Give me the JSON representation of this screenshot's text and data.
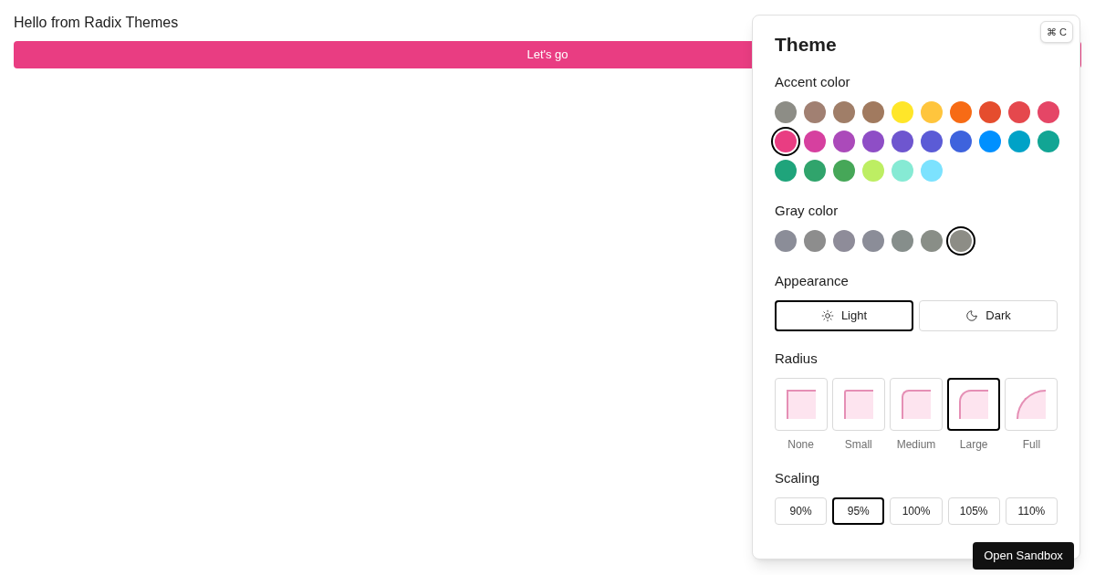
{
  "page": {
    "greeting": "Hello from Radix Themes",
    "button": "Let's go"
  },
  "panel": {
    "title": "Theme",
    "shortcut": "⌘ C",
    "accent": {
      "label": "Accent color",
      "swatches": [
        {
          "color": "#8d8d86",
          "selected": false
        },
        {
          "color": "#a18072",
          "selected": false
        },
        {
          "color": "#a07e68",
          "selected": false
        },
        {
          "color": "#a17a5f",
          "selected": false
        },
        {
          "color": "#ffe629",
          "selected": false
        },
        {
          "color": "#ffc53d",
          "selected": false
        },
        {
          "color": "#f76b15",
          "selected": false
        },
        {
          "color": "#e54d2e",
          "selected": false
        },
        {
          "color": "#e5484d",
          "selected": false
        },
        {
          "color": "#e54666",
          "selected": false
        },
        {
          "color": "#e93d82",
          "selected": true
        },
        {
          "color": "#d6409f",
          "selected": false
        },
        {
          "color": "#ab4aba",
          "selected": false
        },
        {
          "color": "#8e4ec6",
          "selected": false
        },
        {
          "color": "#6e56cf",
          "selected": false
        },
        {
          "color": "#5b5bd6",
          "selected": false
        },
        {
          "color": "#3e63dd",
          "selected": false
        },
        {
          "color": "#0090ff",
          "selected": false
        },
        {
          "color": "#00a2c7",
          "selected": false
        },
        {
          "color": "#12a594",
          "selected": false
        },
        {
          "color": "#1fa47b",
          "selected": false
        },
        {
          "color": "#30a46c",
          "selected": false
        },
        {
          "color": "#46a758",
          "selected": false
        },
        {
          "color": "#bdee63",
          "selected": false
        },
        {
          "color": "#86ead4",
          "selected": false
        },
        {
          "color": "#7ce2fe",
          "selected": false
        }
      ]
    },
    "gray": {
      "label": "Gray color",
      "swatches": [
        {
          "color": "#8b8d98",
          "selected": false
        },
        {
          "color": "#8d8d8d",
          "selected": false
        },
        {
          "color": "#8e8c99",
          "selected": false
        },
        {
          "color": "#8b8d98",
          "selected": false
        },
        {
          "color": "#868e8b",
          "selected": false
        },
        {
          "color": "#898e87",
          "selected": false
        },
        {
          "color": "#8d8d86",
          "selected": true
        }
      ]
    },
    "appearance": {
      "label": "Appearance",
      "options": [
        {
          "kind": "light",
          "label": "Light",
          "selected": true
        },
        {
          "kind": "dark",
          "label": "Dark",
          "selected": false
        }
      ]
    },
    "radius": {
      "label": "Radius",
      "options": [
        {
          "kind": "none",
          "label": "None",
          "selected": false
        },
        {
          "kind": "small",
          "label": "Small",
          "selected": false
        },
        {
          "kind": "medium",
          "label": "Medium",
          "selected": false
        },
        {
          "kind": "large",
          "label": "Large",
          "selected": true
        },
        {
          "kind": "full",
          "label": "Full",
          "selected": false
        }
      ]
    },
    "scaling": {
      "label": "Scaling",
      "options": [
        {
          "label": "90%",
          "selected": false
        },
        {
          "label": "95%",
          "selected": true
        },
        {
          "label": "100%",
          "selected": false
        },
        {
          "label": "105%",
          "selected": false
        },
        {
          "label": "110%",
          "selected": false
        }
      ]
    }
  },
  "sandbox_button": "Open Sandbox"
}
